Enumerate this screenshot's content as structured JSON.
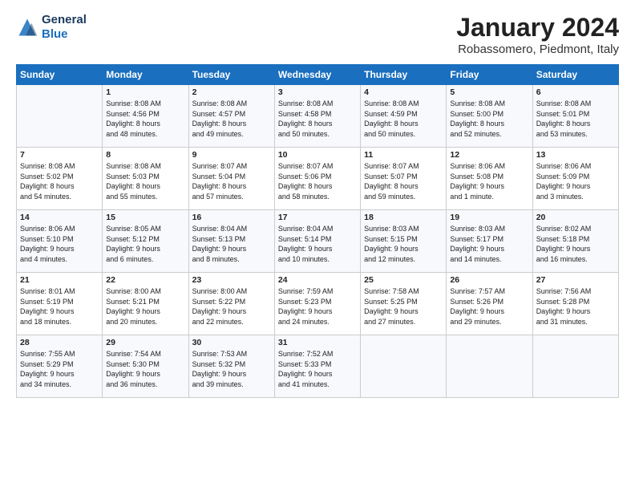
{
  "header": {
    "logo_general": "General",
    "logo_blue": "Blue",
    "month_title": "January 2024",
    "location": "Robassomero, Piedmont, Italy"
  },
  "days_of_week": [
    "Sunday",
    "Monday",
    "Tuesday",
    "Wednesday",
    "Thursday",
    "Friday",
    "Saturday"
  ],
  "weeks": [
    [
      {
        "num": "",
        "info": ""
      },
      {
        "num": "1",
        "info": "Sunrise: 8:08 AM\nSunset: 4:56 PM\nDaylight: 8 hours\nand 48 minutes."
      },
      {
        "num": "2",
        "info": "Sunrise: 8:08 AM\nSunset: 4:57 PM\nDaylight: 8 hours\nand 49 minutes."
      },
      {
        "num": "3",
        "info": "Sunrise: 8:08 AM\nSunset: 4:58 PM\nDaylight: 8 hours\nand 50 minutes."
      },
      {
        "num": "4",
        "info": "Sunrise: 8:08 AM\nSunset: 4:59 PM\nDaylight: 8 hours\nand 50 minutes."
      },
      {
        "num": "5",
        "info": "Sunrise: 8:08 AM\nSunset: 5:00 PM\nDaylight: 8 hours\nand 52 minutes."
      },
      {
        "num": "6",
        "info": "Sunrise: 8:08 AM\nSunset: 5:01 PM\nDaylight: 8 hours\nand 53 minutes."
      }
    ],
    [
      {
        "num": "7",
        "info": "Sunrise: 8:08 AM\nSunset: 5:02 PM\nDaylight: 8 hours\nand 54 minutes."
      },
      {
        "num": "8",
        "info": "Sunrise: 8:08 AM\nSunset: 5:03 PM\nDaylight: 8 hours\nand 55 minutes."
      },
      {
        "num": "9",
        "info": "Sunrise: 8:07 AM\nSunset: 5:04 PM\nDaylight: 8 hours\nand 57 minutes."
      },
      {
        "num": "10",
        "info": "Sunrise: 8:07 AM\nSunset: 5:06 PM\nDaylight: 8 hours\nand 58 minutes."
      },
      {
        "num": "11",
        "info": "Sunrise: 8:07 AM\nSunset: 5:07 PM\nDaylight: 8 hours\nand 59 minutes."
      },
      {
        "num": "12",
        "info": "Sunrise: 8:06 AM\nSunset: 5:08 PM\nDaylight: 9 hours\nand 1 minute."
      },
      {
        "num": "13",
        "info": "Sunrise: 8:06 AM\nSunset: 5:09 PM\nDaylight: 9 hours\nand 3 minutes."
      }
    ],
    [
      {
        "num": "14",
        "info": "Sunrise: 8:06 AM\nSunset: 5:10 PM\nDaylight: 9 hours\nand 4 minutes."
      },
      {
        "num": "15",
        "info": "Sunrise: 8:05 AM\nSunset: 5:12 PM\nDaylight: 9 hours\nand 6 minutes."
      },
      {
        "num": "16",
        "info": "Sunrise: 8:04 AM\nSunset: 5:13 PM\nDaylight: 9 hours\nand 8 minutes."
      },
      {
        "num": "17",
        "info": "Sunrise: 8:04 AM\nSunset: 5:14 PM\nDaylight: 9 hours\nand 10 minutes."
      },
      {
        "num": "18",
        "info": "Sunrise: 8:03 AM\nSunset: 5:15 PM\nDaylight: 9 hours\nand 12 minutes."
      },
      {
        "num": "19",
        "info": "Sunrise: 8:03 AM\nSunset: 5:17 PM\nDaylight: 9 hours\nand 14 minutes."
      },
      {
        "num": "20",
        "info": "Sunrise: 8:02 AM\nSunset: 5:18 PM\nDaylight: 9 hours\nand 16 minutes."
      }
    ],
    [
      {
        "num": "21",
        "info": "Sunrise: 8:01 AM\nSunset: 5:19 PM\nDaylight: 9 hours\nand 18 minutes."
      },
      {
        "num": "22",
        "info": "Sunrise: 8:00 AM\nSunset: 5:21 PM\nDaylight: 9 hours\nand 20 minutes."
      },
      {
        "num": "23",
        "info": "Sunrise: 8:00 AM\nSunset: 5:22 PM\nDaylight: 9 hours\nand 22 minutes."
      },
      {
        "num": "24",
        "info": "Sunrise: 7:59 AM\nSunset: 5:23 PM\nDaylight: 9 hours\nand 24 minutes."
      },
      {
        "num": "25",
        "info": "Sunrise: 7:58 AM\nSunset: 5:25 PM\nDaylight: 9 hours\nand 27 minutes."
      },
      {
        "num": "26",
        "info": "Sunrise: 7:57 AM\nSunset: 5:26 PM\nDaylight: 9 hours\nand 29 minutes."
      },
      {
        "num": "27",
        "info": "Sunrise: 7:56 AM\nSunset: 5:28 PM\nDaylight: 9 hours\nand 31 minutes."
      }
    ],
    [
      {
        "num": "28",
        "info": "Sunrise: 7:55 AM\nSunset: 5:29 PM\nDaylight: 9 hours\nand 34 minutes."
      },
      {
        "num": "29",
        "info": "Sunrise: 7:54 AM\nSunset: 5:30 PM\nDaylight: 9 hours\nand 36 minutes."
      },
      {
        "num": "30",
        "info": "Sunrise: 7:53 AM\nSunset: 5:32 PM\nDaylight: 9 hours\nand 39 minutes."
      },
      {
        "num": "31",
        "info": "Sunrise: 7:52 AM\nSunset: 5:33 PM\nDaylight: 9 hours\nand 41 minutes."
      },
      {
        "num": "",
        "info": ""
      },
      {
        "num": "",
        "info": ""
      },
      {
        "num": "",
        "info": ""
      }
    ]
  ]
}
